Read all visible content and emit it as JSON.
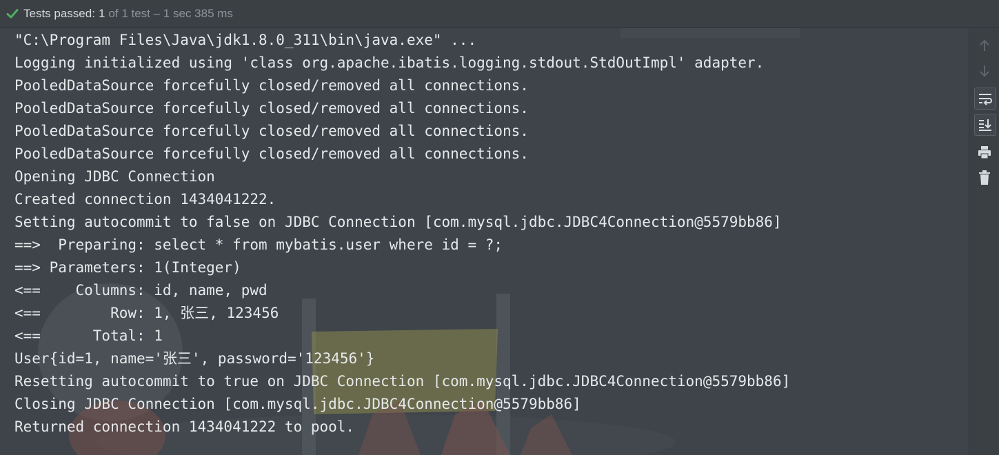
{
  "status": {
    "label": "Tests passed:",
    "count": "1",
    "rest": "of 1 test – 1 sec 385 ms",
    "accent": "#4fae5f"
  },
  "console": {
    "lines": [
      "\"C:\\Program Files\\Java\\jdk1.8.0_311\\bin\\java.exe\" ...",
      "Logging initialized using 'class org.apache.ibatis.logging.stdout.StdOutImpl' adapter.",
      "PooledDataSource forcefully closed/removed all connections.",
      "PooledDataSource forcefully closed/removed all connections.",
      "PooledDataSource forcefully closed/removed all connections.",
      "PooledDataSource forcefully closed/removed all connections.",
      "Opening JDBC Connection",
      "Created connection 1434041222.",
      "Setting autocommit to false on JDBC Connection [com.mysql.jdbc.JDBC4Connection@5579bb86]",
      "==>  Preparing: select * from mybatis.user where id = ?;",
      "==> Parameters: 1(Integer)",
      "<==    Columns: id, name, pwd",
      "<==        Row: 1, 张三, 123456",
      "<==      Total: 1",
      "User{id=1, name='张三', password='123456'}",
      "Resetting autocommit to true on JDBC Connection [com.mysql.jdbc.JDBC4Connection@5579bb86]",
      "Closing JDBC Connection [com.mysql.jdbc.JDBC4Connection@5579bb86]",
      "Returned connection 1434041222 to pool."
    ]
  },
  "toolbar": {
    "icons": [
      "arrow-up-icon",
      "arrow-down-icon",
      "soft-wrap-icon",
      "scroll-to-end-icon",
      "print-icon",
      "trash-icon"
    ]
  }
}
